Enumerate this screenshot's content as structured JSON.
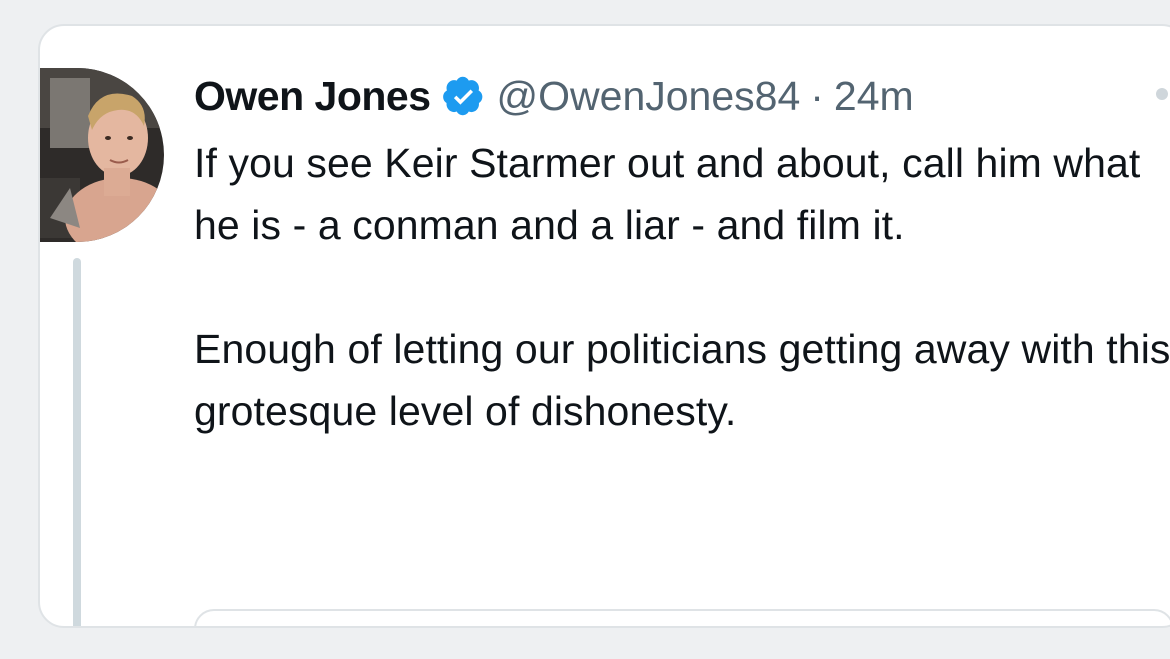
{
  "tweet": {
    "author_name": "Owen Jones",
    "handle": "@OwenJones84",
    "separator": "·",
    "timestamp": "24m",
    "paragraphs": [
      "If you see Keir Starmer out and about, call him what he is - a conman and a liar - and film it.",
      "Enough of letting our politicians getting away with this grotesque level of dishonesty."
    ]
  },
  "icons": {
    "verified": "verified-badge-icon",
    "more": "more-options-icon"
  },
  "colors": {
    "verified_blue": "#1d9bf0",
    "secondary_text": "#536471",
    "text": "#0f1419"
  }
}
